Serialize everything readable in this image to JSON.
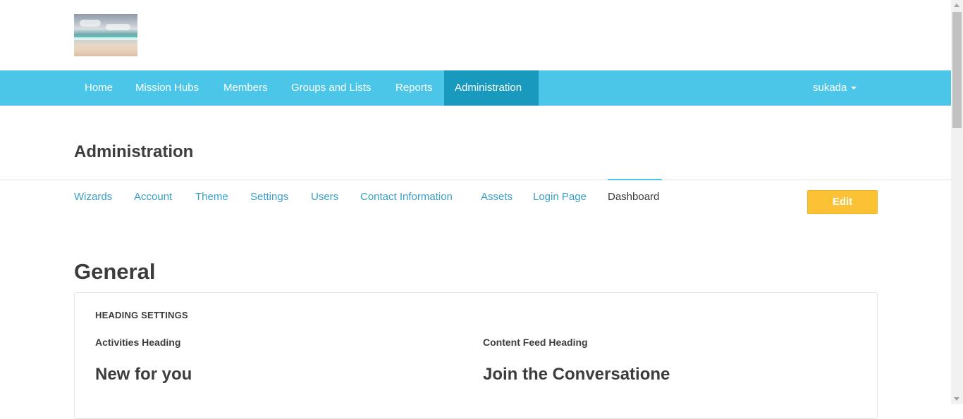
{
  "header": {
    "logo_name": "beach-logo"
  },
  "nav": {
    "items": [
      {
        "label": "Home"
      },
      {
        "label": "Mission Hubs"
      },
      {
        "label": "Members"
      },
      {
        "label": "Groups and Lists"
      },
      {
        "label": "Reports"
      },
      {
        "label": "Administration",
        "active": true
      }
    ],
    "user": "sukada",
    "bg_color": "#4bc6e8",
    "active_color": "#1899bd"
  },
  "page": {
    "title": "Administration",
    "subnav": [
      {
        "label": "Wizards"
      },
      {
        "label": "Account"
      },
      {
        "label": "Theme"
      },
      {
        "label": "Settings"
      },
      {
        "label": "Users"
      },
      {
        "label": "Contact Information"
      },
      {
        "label": "Assets"
      },
      {
        "label": "Login Page"
      },
      {
        "label": "Dashboard",
        "active": true
      }
    ],
    "edit_label": "Edit",
    "edit_color": "#fcc236"
  },
  "general": {
    "title": "General",
    "card": {
      "heading": "HEADING SETTINGS",
      "fields": [
        {
          "label": "Activities Heading",
          "value": "New for you"
        },
        {
          "label": "Content Feed Heading",
          "value": "Join the Conversatione"
        }
      ]
    }
  }
}
